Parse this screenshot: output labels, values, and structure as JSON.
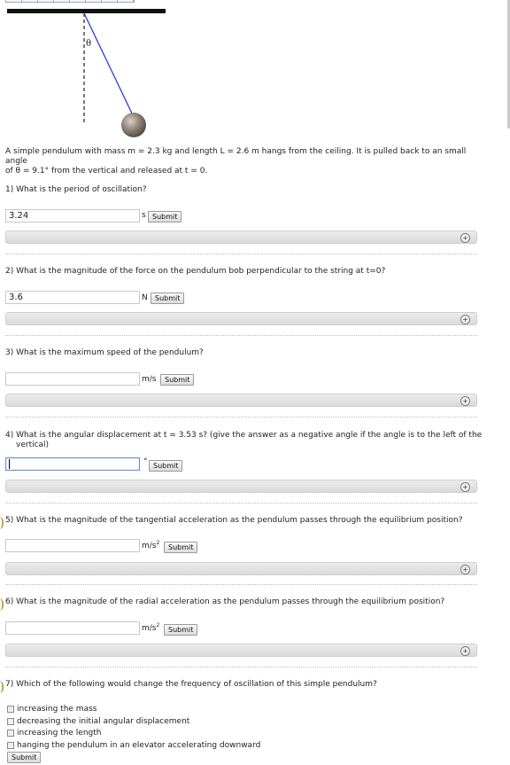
{
  "figure": {
    "angle_symbol": "θ"
  },
  "problem": {
    "line1": "A simple pendulum with mass m = 2.3 kg and length L = 2.6 m hangs from the ceiling. It is pulled back to an small angle",
    "line2": "of θ = 9.1° from the vertical and released at t = 0."
  },
  "submit_label": "Submit",
  "questions": [
    {
      "text": "1) What is the period of oscillation?",
      "value": "3.24",
      "unit": "s"
    },
    {
      "text": "2) What is the magnitude of the force on the pendulum bob perpendicular to the string at t=0?",
      "value": "3.6",
      "unit": "N"
    },
    {
      "text": "3) What is the maximum speed of the pendulum?",
      "value": "",
      "unit": "m/s"
    },
    {
      "text_line1": "4) What is the angular displacement at t = 3.53 s? (give the answer as a negative angle if the angle is to the left of the",
      "text_line2": "vertical)",
      "value": "",
      "unit": "°"
    },
    {
      "text": "5) What is the magnitude of the tangential acceleration as the pendulum passes through the equilibrium position?",
      "value": "",
      "unit": "m/s",
      "unit_sup": "2"
    },
    {
      "text": "6) What is the magnitude of the radial acceleration as the pendulum passes through the equilibrium position?",
      "value": "",
      "unit": "m/s",
      "unit_sup": "2"
    },
    {
      "text": "7) Which of the following would change the frequency of oscillation of this simple pendulum?",
      "choices": [
        "increasing the mass",
        "decreasing the initial angular displacement",
        "increasing the length",
        "hanging the pendulum in an elevator accelerating downward"
      ]
    }
  ],
  "hint_icon": "plus-circle-icon",
  "colors": {
    "string": "#2a3fd4",
    "ceiling": "#111111",
    "bob": "#8a7e72",
    "active_border": "#6e8bd4"
  }
}
